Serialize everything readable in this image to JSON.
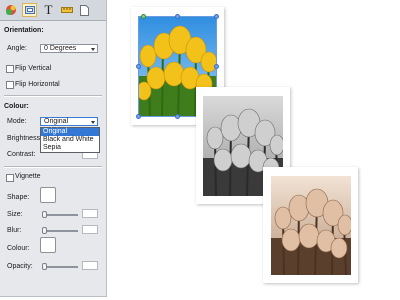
{
  "toolbar": {
    "tools": [
      {
        "name": "effects-tool-icon"
      },
      {
        "name": "frame-tool-icon"
      },
      {
        "name": "text-tool-icon",
        "label": "T"
      },
      {
        "name": "ruler-tool-icon"
      },
      {
        "name": "page-tool-icon"
      }
    ]
  },
  "orientation": {
    "heading": "Orientation:",
    "angle_label": "Angle:",
    "angle_value": "0 Degrees",
    "flip_vertical": "Flip Vertical",
    "flip_horizontal": "Flip Horizontal"
  },
  "colour": {
    "heading": "Colour:",
    "mode_label": "Mode:",
    "mode_value": "Original",
    "options": [
      "Original",
      "Black and White",
      "Sepia"
    ],
    "brightness_label": "Brightness:",
    "contrast_label": "Contrast:"
  },
  "vignette": {
    "label": "Vignette",
    "shape_label": "Shape:",
    "size_label": "Size:",
    "blur_label": "Blur:",
    "colour_label": "Colour:",
    "opacity_label": "Opacity:"
  },
  "colors": {
    "selection_handle": "#6fa2e8",
    "rotate_handle": "#7fce7f",
    "dropdown_highlight": "#3478d6"
  }
}
